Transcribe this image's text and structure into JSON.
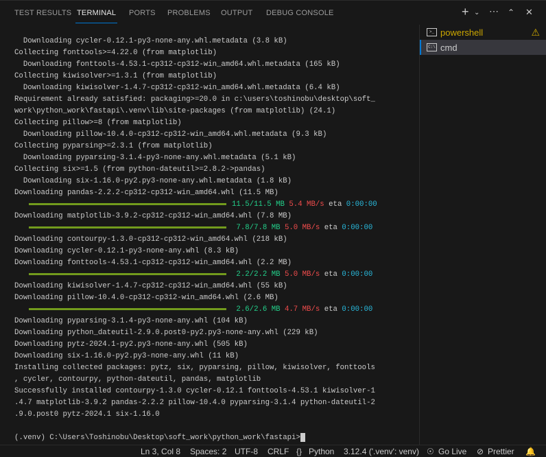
{
  "panel_tabs": [
    "TEST RESULTS",
    "TERMINAL",
    "PORTS",
    "PROBLEMS",
    "OUTPUT",
    "DEBUG CONSOLE"
  ],
  "terminal_list": [
    {
      "label": "powershell",
      "color": "#cca700",
      "warning": true
    },
    {
      "label": "cmd",
      "selected": true
    }
  ],
  "terminal_lines": [
    {
      "t": "  Downloading cycler-0.12.1-py3-none-any.whl.metadata (3.8 kB)"
    },
    {
      "t": "Collecting fonttools>=4.22.0 (from matplotlib)"
    },
    {
      "t": "  Downloading fonttools-4.53.1-cp312-cp312-win_amd64.whl.metadata (165 kB)"
    },
    {
      "t": "Collecting kiwisolver>=1.3.1 (from matplotlib)"
    },
    {
      "t": "  Downloading kiwisolver-1.4.7-cp312-cp312-win_amd64.whl.metadata (6.4 kB)"
    },
    {
      "t": "Requirement already satisfied: packaging>=20.0 in c:\\users\\toshinobu\\desktop\\soft_"
    },
    {
      "t": "work\\python_work\\fastapi\\.venv\\lib\\site-packages (from matplotlib) (24.1)"
    },
    {
      "t": "Collecting pillow>=8 (from matplotlib)"
    },
    {
      "t": "  Downloading pillow-10.4.0-cp312-cp312-win_amd64.whl.metadata (9.3 kB)"
    },
    {
      "t": "Collecting pyparsing>=2.3.1 (from matplotlib)"
    },
    {
      "t": "  Downloading pyparsing-3.1.4-py3-none-any.whl.metadata (5.1 kB)"
    },
    {
      "t": "Collecting six>=1.5 (from python-dateutil>=2.8.2->pandas)"
    },
    {
      "t": "  Downloading six-1.16.0-py2.py3-none-any.whl.metadata (1.8 kB)"
    },
    {
      "t": "Downloading pandas-2.2.2-cp312-cp312-win_amd64.whl (11.5 MB)"
    },
    {
      "bar": true,
      "size": "11.5/11.5 MB",
      "speed": "5.4 MB/s",
      "eta_label": "eta",
      "eta": "0:00:00",
      "progress": 1.0
    },
    {
      "t": "Downloading matplotlib-3.9.2-cp312-cp312-win_amd64.whl (7.8 MB)"
    },
    {
      "bar": true,
      "size": " 7.8/7.8 MB",
      "speed": "5.0 MB/s",
      "eta_label": "eta",
      "eta": "0:00:00",
      "progress": 1.0
    },
    {
      "t": "Downloading contourpy-1.3.0-cp312-cp312-win_amd64.whl (218 kB)"
    },
    {
      "t": "Downloading cycler-0.12.1-py3-none-any.whl (8.3 kB)"
    },
    {
      "t": "Downloading fonttools-4.53.1-cp312-cp312-win_amd64.whl (2.2 MB)"
    },
    {
      "bar": true,
      "size": " 2.2/2.2 MB",
      "speed": "5.0 MB/s",
      "eta_label": "eta",
      "eta": "0:00:00",
      "progress": 1.0
    },
    {
      "t": "Downloading kiwisolver-1.4.7-cp312-cp312-win_amd64.whl (55 kB)"
    },
    {
      "t": "Downloading pillow-10.4.0-cp312-cp312-win_amd64.whl (2.6 MB)"
    },
    {
      "bar": true,
      "size": " 2.6/2.6 MB",
      "speed": "4.7 MB/s",
      "eta_label": "eta",
      "eta": "0:00:00",
      "progress": 1.0
    },
    {
      "t": "Downloading pyparsing-3.1.4-py3-none-any.whl (104 kB)"
    },
    {
      "t": "Downloading python_dateutil-2.9.0.post0-py2.py3-none-any.whl (229 kB)"
    },
    {
      "t": "Downloading pytz-2024.1-py2.py3-none-any.whl (505 kB)"
    },
    {
      "t": "Downloading six-1.16.0-py2.py3-none-any.whl (11 kB)"
    },
    {
      "t": "Installing collected packages: pytz, six, pyparsing, pillow, kiwisolver, fonttools"
    },
    {
      "t": ", cycler, contourpy, python-dateutil, pandas, matplotlib"
    },
    {
      "t": "Successfully installed contourpy-1.3.0 cycler-0.12.1 fonttools-4.53.1 kiwisolver-1"
    },
    {
      "t": ".4.7 matplotlib-3.9.2 pandas-2.2.2 pillow-10.4.0 pyparsing-3.1.4 python-dateutil-2"
    },
    {
      "t": ".9.0.post0 pytz-2024.1 six-1.16.0"
    },
    {
      "t": ""
    },
    {
      "t": "(.venv) C:\\Users\\Toshinobu\\Desktop\\soft_work\\python_work\\fastapi>",
      "prompt": true
    }
  ],
  "status_bar": {
    "position": "Ln 3, Col 8",
    "spaces": "Spaces: 2",
    "encoding": "UTF-8",
    "eol": "CRLF",
    "language": "Python",
    "interpreter": "3.12.4 ('.venv': venv)",
    "go_live": "Go Live",
    "prettier": "Prettier"
  },
  "colors": {
    "accent": "#0078d4",
    "bar": "#729b1d",
    "green": "#23d18b",
    "red": "#f14c4c",
    "blue": "#29b8db",
    "warning": "#cca700"
  }
}
